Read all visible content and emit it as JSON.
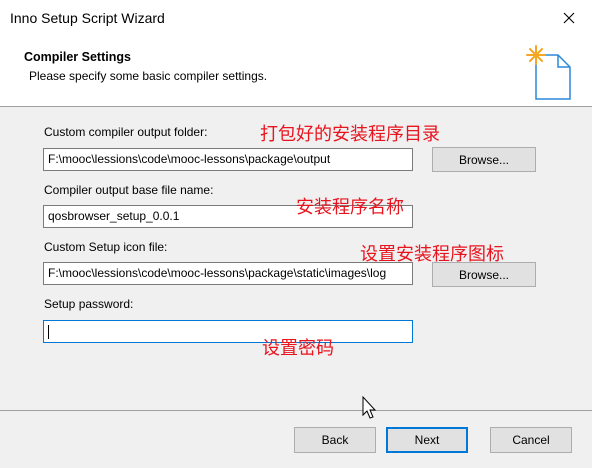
{
  "window": {
    "title": "Inno Setup Script Wizard",
    "close_icon": "close-icon"
  },
  "header": {
    "title": "Compiler Settings",
    "subtitle": "Please specify some basic compiler settings.",
    "icon": "wizard-sparkle-document-icon"
  },
  "form": {
    "output_folder_label": "Custom compiler output folder:",
    "output_folder_value": "F:\\mooc\\lessions\\code\\mooc-lessons\\package\\output",
    "base_name_label": "Compiler output base file name:",
    "base_name_value": "qosbrowser_setup_0.0.1",
    "icon_file_label": "Custom Setup icon file:",
    "icon_file_value": "F:\\mooc\\lessions\\code\\mooc-lessons\\package\\static\\images\\log",
    "password_label": "Setup password:",
    "password_value": "",
    "browse_label": "Browse..."
  },
  "annotations": {
    "output_folder": "打包好的安装程序目录",
    "base_name": "安装程序名称",
    "icon_file": "设置安装程序图标",
    "password": "设置密码"
  },
  "buttons": {
    "back": "Back",
    "next": "Next",
    "cancel": "Cancel"
  },
  "colors": {
    "annotation": "#e8141e",
    "focus": "#0078d7",
    "icon_accent": "#f5a623",
    "icon_outline": "#2b88d8"
  }
}
